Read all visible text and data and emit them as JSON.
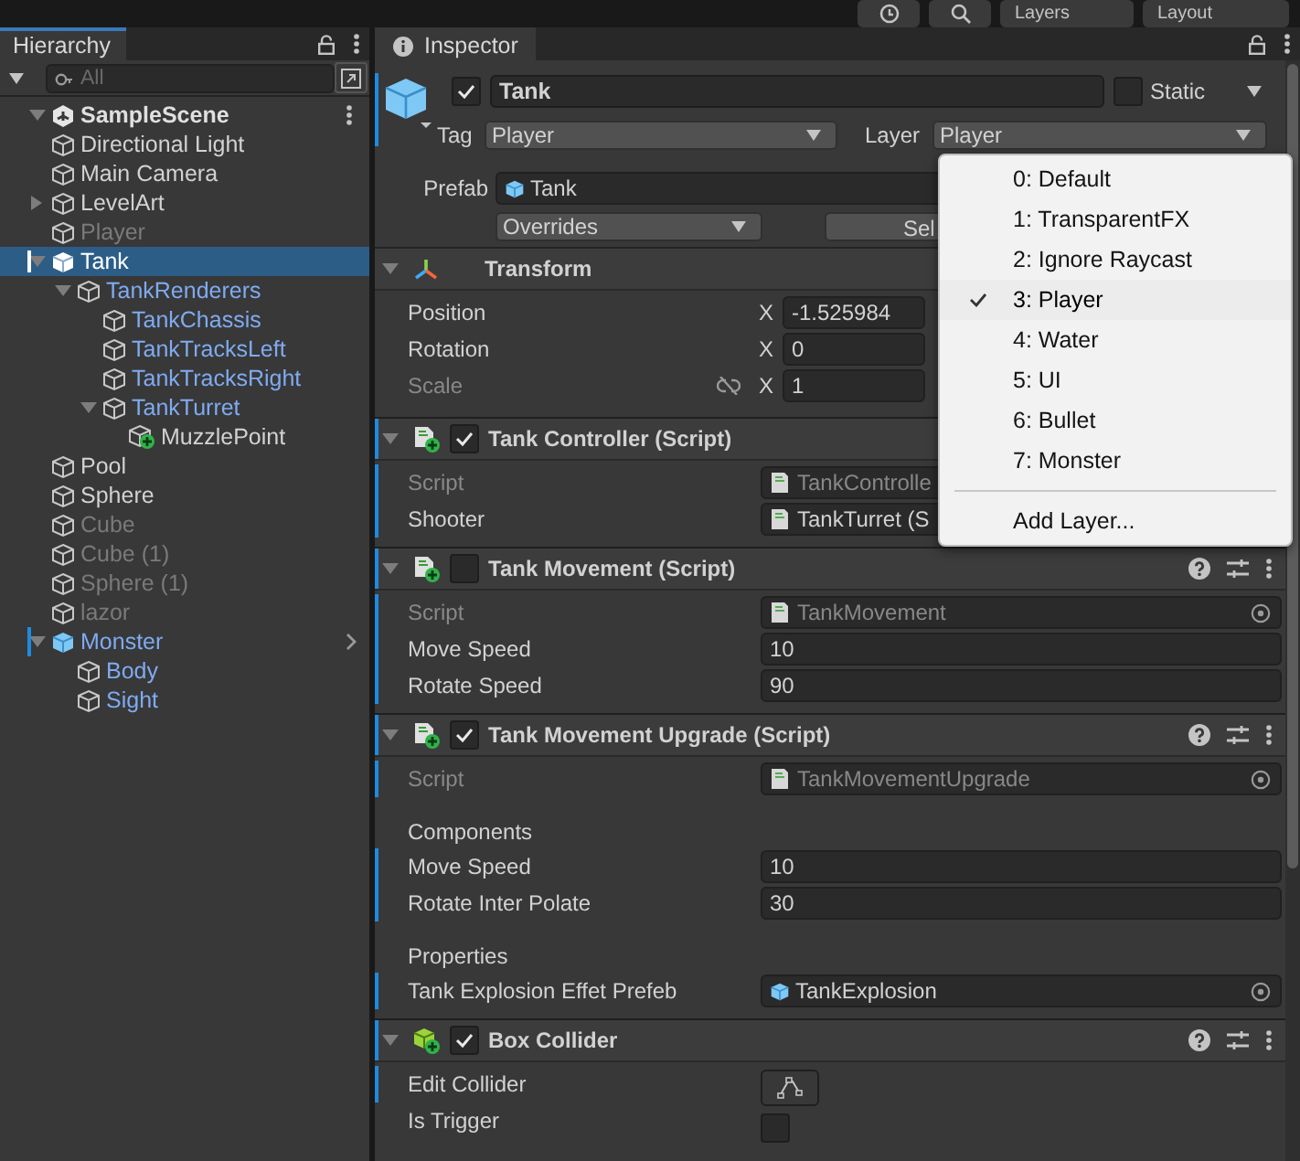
{
  "toolbar": {
    "layers": "Layers",
    "layout": "Layout"
  },
  "hierarchy": {
    "title": "Hierarchy",
    "search": {
      "placeholder": "All"
    },
    "scene": {
      "name": "SampleScene",
      "expanded": true,
      "children": [
        {
          "name": "Directional Light",
          "kind": "object",
          "active": true,
          "selected": false
        },
        {
          "name": "Main Camera",
          "kind": "object",
          "active": true,
          "selected": false
        },
        {
          "name": "LevelArt",
          "kind": "object",
          "active": true,
          "selected": false,
          "expanded": false
        },
        {
          "name": "Player",
          "kind": "object",
          "active": false,
          "selected": false
        },
        {
          "name": "Tank",
          "kind": "prefab",
          "active": true,
          "selected": true,
          "expanded": true,
          "children": [
            {
              "name": "TankRenderers",
              "kind": "prefab_part",
              "active": true,
              "selected": false,
              "expanded": true,
              "children": [
                {
                  "name": "TankChassis",
                  "kind": "prefab_part",
                  "active": true,
                  "selected": false
                },
                {
                  "name": "TankTracksLeft",
                  "kind": "prefab_part",
                  "active": true,
                  "selected": false
                },
                {
                  "name": "TankTracksRight",
                  "kind": "prefab_part",
                  "active": true,
                  "selected": false
                },
                {
                  "name": "TankTurret",
                  "kind": "prefab_part",
                  "active": true,
                  "selected": false,
                  "expanded": true,
                  "children": [
                    {
                      "name": "MuzzlePoint",
                      "kind": "added",
                      "active": true,
                      "selected": false
                    }
                  ]
                }
              ]
            }
          ]
        },
        {
          "name": "Pool",
          "kind": "object",
          "active": true,
          "selected": false
        },
        {
          "name": "Sphere",
          "kind": "object",
          "active": true,
          "selected": false
        },
        {
          "name": "Cube",
          "kind": "object",
          "active": false,
          "selected": false
        },
        {
          "name": "Cube (1)",
          "kind": "object",
          "active": false,
          "selected": false
        },
        {
          "name": "Sphere (1)",
          "kind": "object",
          "active": false,
          "selected": false
        },
        {
          "name": "lazor",
          "kind": "object",
          "active": false,
          "selected": false
        },
        {
          "name": "Monster",
          "kind": "prefab",
          "active": true,
          "selected": false,
          "expanded": true,
          "marked": true,
          "open_arrow": true,
          "children": [
            {
              "name": "Body",
              "kind": "prefab_part",
              "active": true,
              "selected": false
            },
            {
              "name": "Sight",
              "kind": "prefab_part",
              "active": true,
              "selected": false
            }
          ]
        }
      ]
    }
  },
  "inspector": {
    "title": "Inspector",
    "object": {
      "active": true,
      "name": "Tank",
      "static": false,
      "static_label": "Static",
      "tag_label": "Tag",
      "tag": "Player",
      "layer_label": "Layer",
      "layer": "Player",
      "prefab_label": "Prefab",
      "prefab": "Tank",
      "overrides": "Overrides",
      "select": "Sel"
    },
    "transform": {
      "title": "Transform",
      "expanded": true,
      "rows": [
        {
          "kind": "vector",
          "label": "Position",
          "axis": "X",
          "value": "-1.525984"
        },
        {
          "kind": "vector",
          "label": "Rotation",
          "axis": "X",
          "value": "0"
        },
        {
          "kind": "scale",
          "label": "Scale",
          "axis": "X",
          "value": "1"
        }
      ]
    },
    "components": [
      {
        "title": "Tank Controller (Script)",
        "kind": "script",
        "enabled": true,
        "tools": false,
        "override": true,
        "rows": [
          {
            "kind": "script_ref",
            "label": "Script",
            "value": "TankControlle",
            "disabled": true,
            "override": true
          },
          {
            "kind": "script_ref",
            "label": "Shooter",
            "value": "TankTurret (S",
            "disabled": false,
            "override": true
          }
        ]
      },
      {
        "title": "Tank Movement (Script)",
        "kind": "script",
        "enabled": false,
        "tools": true,
        "override": true,
        "rows": [
          {
            "kind": "script_ref",
            "label": "Script",
            "value": "TankMovement",
            "disabled": true,
            "picker": true,
            "override": true
          },
          {
            "kind": "number",
            "label": "Move Speed",
            "value": "10",
            "override": true
          },
          {
            "kind": "number",
            "label": "Rotate Speed",
            "value": "90",
            "override": true
          }
        ]
      },
      {
        "title": "Tank Movement Upgrade (Script)",
        "kind": "script",
        "enabled": true,
        "tools": true,
        "override": true,
        "rows": [
          {
            "kind": "script_ref",
            "label": "Script",
            "value": "TankMovementUpgrade",
            "disabled": true,
            "picker": true,
            "override": true
          },
          {
            "kind": "heading",
            "label": "Components"
          },
          {
            "kind": "number",
            "label": "Move Speed",
            "value": "10",
            "override": true
          },
          {
            "kind": "number",
            "label": "Rotate Inter Polate",
            "value": "30",
            "override": true
          },
          {
            "kind": "heading",
            "label": "Properties"
          },
          {
            "kind": "prefab_ref",
            "label": "Tank Explosion Effet Prefeb",
            "value": "TankExplosion",
            "disabled": false,
            "picker": true,
            "override": true
          }
        ]
      },
      {
        "title": "Box Collider",
        "kind": "collider",
        "enabled": true,
        "tools": true,
        "override": true,
        "rows": [
          {
            "kind": "button",
            "label": "Edit Collider",
            "override": true
          },
          {
            "kind": "checkbox",
            "label": "Is Trigger",
            "checked": false,
            "override": false
          }
        ]
      }
    ]
  },
  "layer_menu": {
    "items": [
      {
        "label": "0: Default",
        "selected": false
      },
      {
        "label": "1: TransparentFX",
        "selected": false
      },
      {
        "label": "2: Ignore Raycast",
        "selected": false
      },
      {
        "label": "3: Player",
        "selected": true
      },
      {
        "label": "4: Water",
        "selected": false
      },
      {
        "label": "5: UI",
        "selected": false
      },
      {
        "label": "6: Bullet",
        "selected": false
      },
      {
        "label": "7: Monster",
        "selected": false
      }
    ],
    "footer": "Add Layer..."
  }
}
